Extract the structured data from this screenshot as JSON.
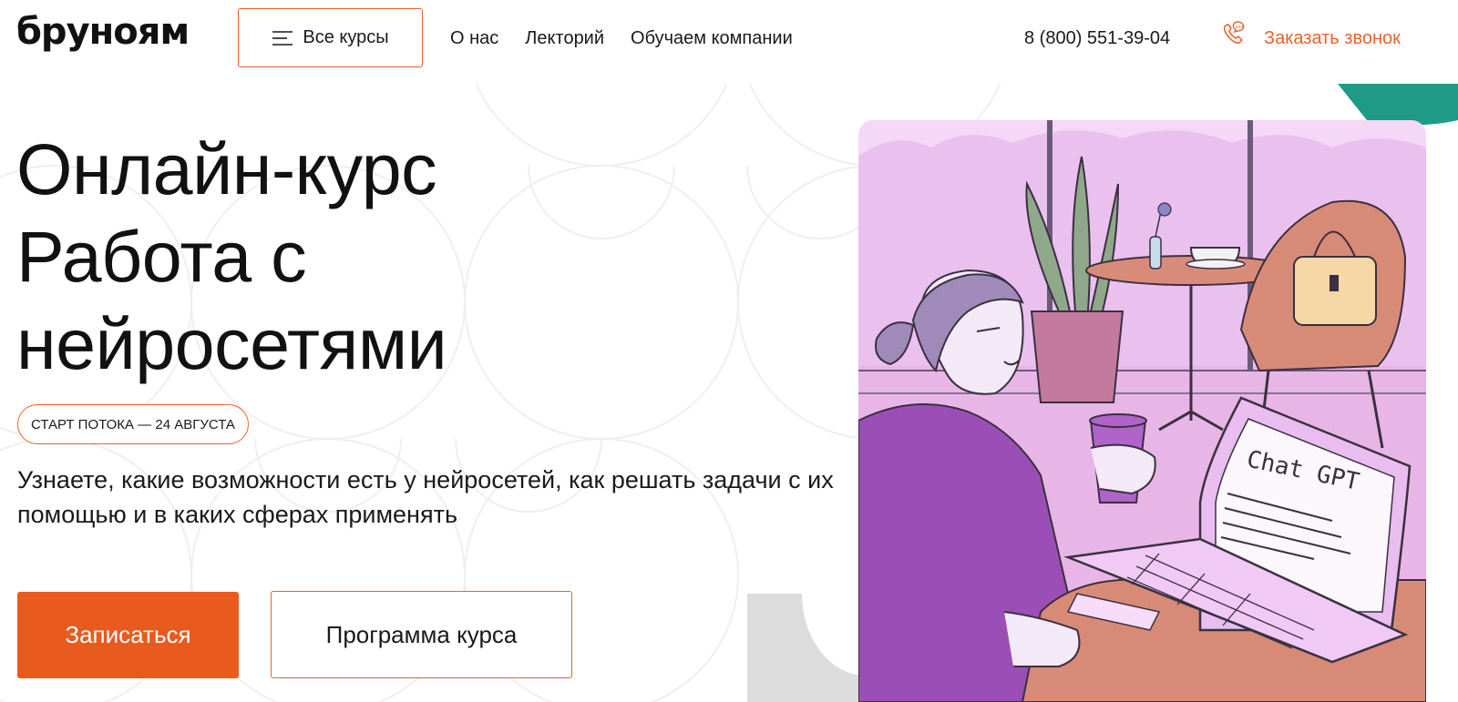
{
  "header": {
    "logo": "бруноям",
    "all_courses_label": "Все курсы",
    "nav": [
      "О нас",
      "Лекторий",
      "Обучаем компании"
    ],
    "phone": "8 (800) 551-39-04",
    "callback_label": "Заказать звонок"
  },
  "hero": {
    "title_lines": [
      "Онлайн-курс",
      "Работа с",
      "нейросетями"
    ],
    "start_badge": "СТАРТ ПОТОКА — 24 АВГУСТА",
    "description": "Узнаете, какие возможности есть у нейросетей, как решать задачи с их помощью и в каких сферах применять",
    "enroll_label": "Записаться",
    "program_label": "Программа курса"
  },
  "illustration": {
    "laptop_text": "Chat GPT"
  },
  "colors": {
    "accent": "#e8622a",
    "button_fill": "#e85a1e",
    "illustration_bg": "#f5d7f7",
    "sweater": "#9b4fb6",
    "teal": "#1f9a86"
  },
  "icons": [
    "menu-icon",
    "phone-call-icon"
  ]
}
